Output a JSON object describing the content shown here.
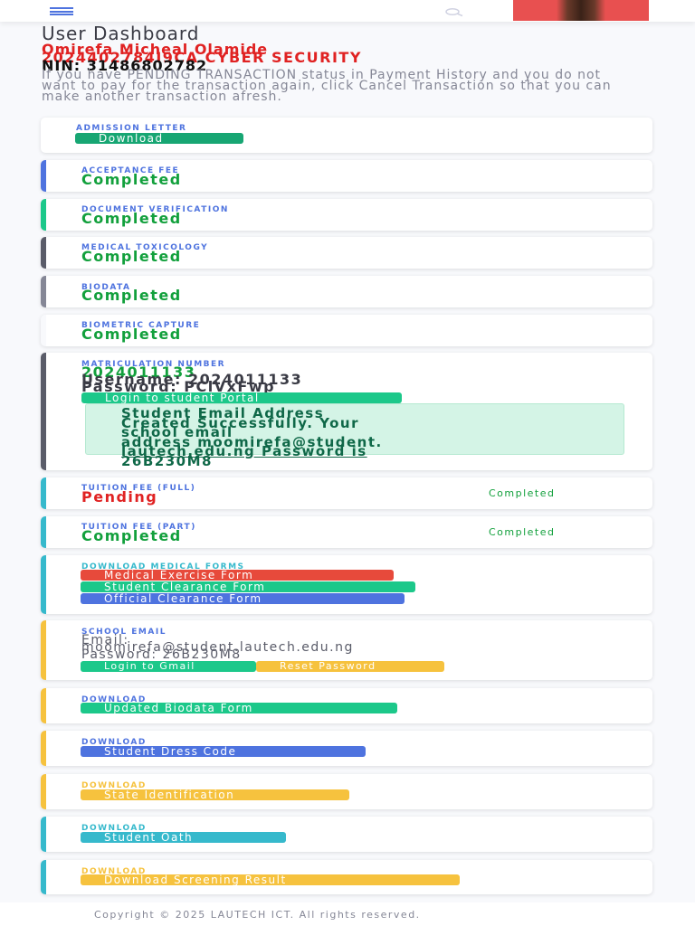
{
  "topbar": {
    "menu_icon": "hamburger-icon",
    "search_icon": "search-icon"
  },
  "header": {
    "title": "User Dashboard",
    "name": "Omirefa Micheal Olamide",
    "programme": "2024402784I9CA CYBER SECURITY",
    "nin": "NIN: 31486802782",
    "notice": "If you have PENDING TRANSACTION status in Payment History and you do not want to pay for the transaction again, click Cancel Transaction so that you can make another transaction afresh."
  },
  "admission": {
    "label": "ADMISSION LETTER",
    "button": "Download"
  },
  "acceptance": {
    "label": "ACCEPTANCE FEE",
    "status": "Completed"
  },
  "document": {
    "label": "DOCUMENT VERIFICATION",
    "status": "Completed"
  },
  "medical": {
    "label": "MEDICAL TOXICOLOGY",
    "status": "Completed"
  },
  "biodata": {
    "label": "BIODATA",
    "status": "Completed"
  },
  "biometric": {
    "label": "BIOMETRIC CAPTURE",
    "status": "Completed"
  },
  "matric": {
    "label": "MATRICULATION NUMBER",
    "number": "2024011133",
    "username": "Username: 2024011133",
    "password": "Password: PClVxFwp",
    "button": "Login to student Portal",
    "alert_line1": "Student Email Address",
    "alert_line2": "Created Successfully. Your",
    "alert_line3": "school email",
    "alert_line4": "address moomirefa@student.",
    "alert_line5": "lautech.edu.ng Password is",
    "alert_line6": "26B230M8"
  },
  "tuition_full": {
    "label": "TUITION FEE (FULL)",
    "status": "Pending",
    "right_status": "Completed"
  },
  "tuition_part": {
    "label": "TUITION FEE (PART)",
    "status": "Completed",
    "right_status": "Completed"
  },
  "medical_forms": {
    "label": "DOWNLOAD MEDICAL FORMS",
    "btn1": "Medical Exercise Form",
    "btn2": "Student Clearance Form",
    "btn3": "Official Clearance Form"
  },
  "school_email": {
    "label": "SCHOOL EMAIL",
    "email_label": "Email:",
    "email": "moomirefa@student.lautech.edu.ng",
    "password": "Password: 26B230M8",
    "btn_login": "Login to Gmail",
    "btn_reset": "Reset Password"
  },
  "dl_biodata": {
    "label": "DOWNLOAD",
    "button": "Updated Biodata Form"
  },
  "dl_dress": {
    "label": "DOWNLOAD",
    "button": "Student Dress Code"
  },
  "dl_state": {
    "label": "DOWNLOAD",
    "button": "State Identification"
  },
  "dl_oath": {
    "label": "DOWNLOAD",
    "button": "Student Oath"
  },
  "dl_screening": {
    "label": "DOWNLOAD",
    "button": "Download Screening Result"
  },
  "footer": {
    "copyright": "Copyright © 2025 LAUTECH ICT. All rights reserved."
  },
  "colors": {
    "primary": "#4e73df",
    "success": "#1cc88a",
    "danger": "#e74a3b",
    "warning": "#f6c23e",
    "info": "#36b9cc",
    "dark": "#5a5c69",
    "secondary": "#858796"
  }
}
